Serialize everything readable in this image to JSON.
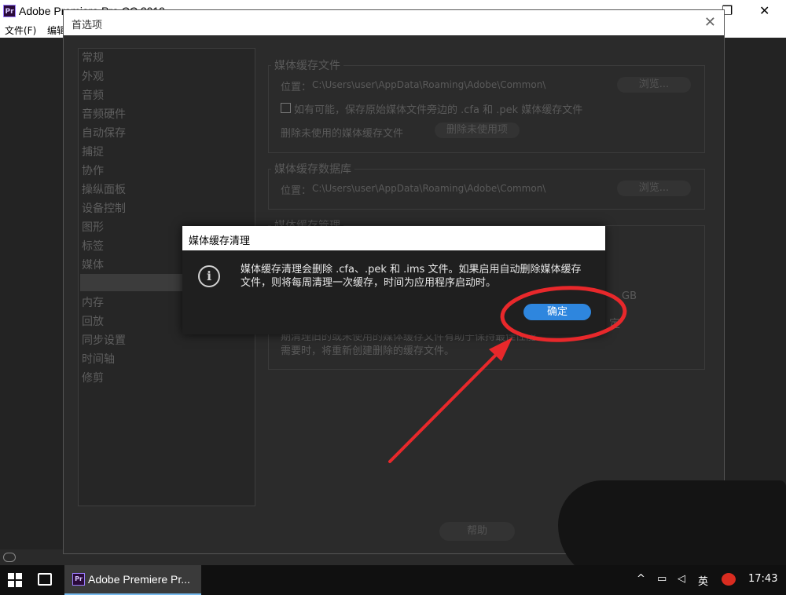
{
  "app": {
    "title": "Adobe Premiere Pro CC 2019",
    "menu": [
      "文件(F)",
      "编辑"
    ]
  },
  "preferences": {
    "title": "首选项",
    "sidebar": [
      "常规",
      "外观",
      "音频",
      "音频硬件",
      "自动保存",
      "捕捉",
      "协作",
      "操纵面板",
      "设备控制",
      "图形",
      "标签",
      "媒体",
      "",
      "内存",
      "回放",
      "同步设置",
      "时间轴",
      "修剪"
    ],
    "media_cache_files": {
      "title": "媒体缓存文件",
      "location_label": "位置：",
      "location_path": "C:\\Users\\user\\AppData\\Roaming\\Adobe\\Common\\",
      "browse": "浏览...",
      "checkbox_label": "如有可能，保存原始媒体文件旁边的 .cfa 和 .pek 媒体缓存文件",
      "delete_label": "删除未使用的媒体缓存文件",
      "delete_button": "删除未使用项"
    },
    "media_cache_db": {
      "title": "媒体缓存数据库",
      "location_label": "位置：",
      "location_path": "C:\\Users\\user\\AppData\\Roaming\\Adobe\\Common\\",
      "browse": "浏览..."
    },
    "media_cache_mgmt": {
      "title": "媒体缓存管理",
      "gb": "GB",
      "fragment": "定",
      "note_line1": "期清理旧的或未使用的媒体缓存文件有助于保持最佳性能。",
      "note_line2": "需要时，将重新创建删除的缓存文件。"
    },
    "help_button": "帮助"
  },
  "message_box": {
    "title": "媒体缓存清理",
    "text": "媒体缓存清理会删除 .cfa、.pek 和 .ims 文件。如果启用自动删除媒体缓存文件，则将每周清理一次缓存，时间为应用程序启动时。",
    "ok_button": "确定"
  },
  "taskbar": {
    "app_label": "Adobe Premiere Pr...",
    "ime": "英",
    "clock": "17:43"
  },
  "colors": {
    "accent": "#2e86de",
    "annotation": "#e8282b"
  }
}
